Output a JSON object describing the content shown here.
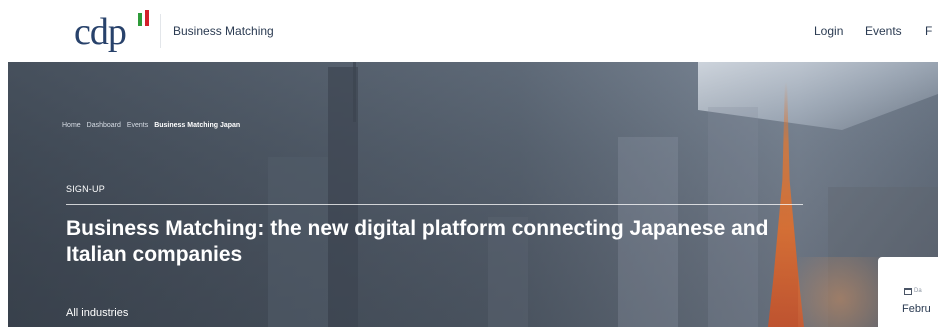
{
  "header": {
    "logo_text": "cdp",
    "brand_subtitle": "Business Matching",
    "nav": {
      "login": "Login",
      "events": "Events",
      "more": "F"
    }
  },
  "hero": {
    "breadcrumb": [
      "Home",
      "Dashboard",
      "Events",
      "Business Matching Japan"
    ],
    "eyebrow": "SIGN-UP",
    "title": "Business Matching: the new digital platform connecting Japanese and Italian companies",
    "industry": "All industries"
  },
  "side_card": {
    "date_label": "Da",
    "date_value": "Febru"
  },
  "colors": {
    "brand_blue": "#28426b",
    "flag_green": "#2e9b3a",
    "flag_red": "#d3202b"
  }
}
